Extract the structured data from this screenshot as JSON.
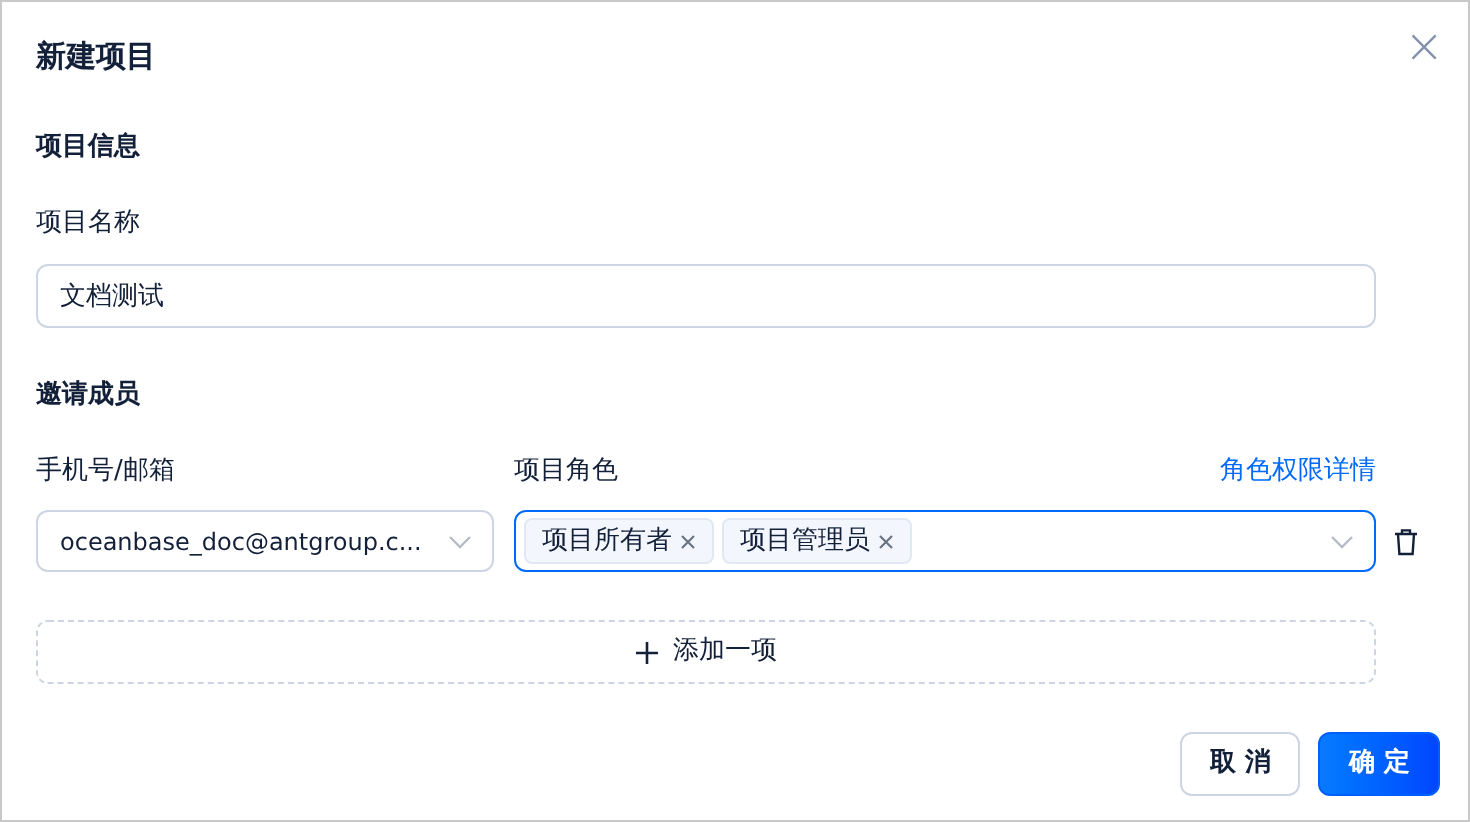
{
  "dialog": {
    "title": "新建项目",
    "close": "×"
  },
  "project_info": {
    "heading": "项目信息",
    "name_label": "项目名称",
    "name_value": "文档测试"
  },
  "members": {
    "heading": "邀请成员",
    "phone_label": "手机号/邮箱",
    "role_label": "项目角色",
    "role_link": "角色权限详情",
    "rows": [
      {
        "email": "oceanbase_doc@antgroup.c...",
        "focused": true,
        "roles": [
          {
            "label": "项目所有者"
          },
          {
            "label": "项目管理员"
          }
        ]
      }
    ],
    "add_button": "添加一项"
  },
  "footer": {
    "buttons": [
      {
        "label": "取 消",
        "kind": "default"
      },
      {
        "label": "确 定",
        "kind": "primary"
      }
    ]
  }
}
